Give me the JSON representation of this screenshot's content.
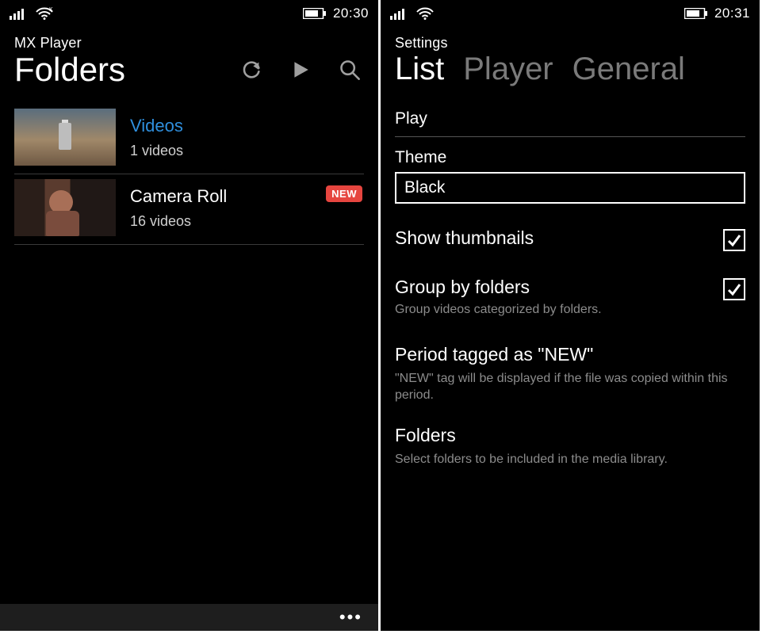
{
  "left": {
    "status": {
      "time": "20:30"
    },
    "app_name": "MX Player",
    "page_title": "Folders",
    "folders": [
      {
        "name": "Videos",
        "count": "1 videos",
        "highlighted": true,
        "new": false
      },
      {
        "name": "Camera Roll",
        "count": "16 videos",
        "highlighted": false,
        "new": true
      }
    ],
    "badge_new_label": "NEW",
    "appbar_more": "•••"
  },
  "right": {
    "status": {
      "time": "20:31"
    },
    "page_header": "Settings",
    "tabs": {
      "list": "List",
      "player": "Player",
      "general": "General"
    },
    "play_label": "Play",
    "theme_label": "Theme",
    "theme_value": "Black",
    "show_thumbnails": {
      "label": "Show thumbnails",
      "checked": true
    },
    "group_by_folders": {
      "label": "Group by folders",
      "desc": "Group videos categorized by folders.",
      "checked": true
    },
    "period_new": {
      "label": "Period tagged as \"NEW\"",
      "desc": "\"NEW\" tag will be displayed if the file was copied within this period."
    },
    "folders_setting": {
      "label": "Folders",
      "desc": "Select folders to be included in the media library."
    }
  }
}
